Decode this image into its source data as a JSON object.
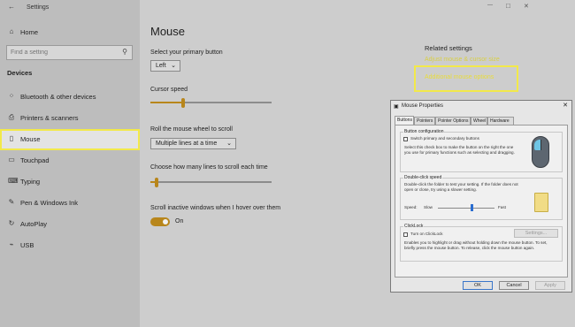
{
  "window": {
    "title": "Settings",
    "back_glyph": "←",
    "minimize_glyph": "—",
    "maximize_glyph": "□",
    "close_glyph": "✕"
  },
  "sidebar": {
    "home_label": "Home",
    "search_placeholder": "Find a setting",
    "section_title": "Devices",
    "items": [
      {
        "label": "Bluetooth & other devices",
        "icon": "bluetooth-icon",
        "glyph": "⁘"
      },
      {
        "label": "Printers & scanners",
        "icon": "printer-icon",
        "glyph": "⎙"
      },
      {
        "label": "Mouse",
        "icon": "mouse-icon",
        "glyph": "▯",
        "active": true
      },
      {
        "label": "Touchpad",
        "icon": "touchpad-icon",
        "glyph": "▭"
      },
      {
        "label": "Typing",
        "icon": "keyboard-icon",
        "glyph": "⌨"
      },
      {
        "label": "Pen & Windows Ink",
        "icon": "pen-icon",
        "glyph": "✎"
      },
      {
        "label": "AutoPlay",
        "icon": "autoplay-icon",
        "glyph": "↻"
      },
      {
        "label": "USB",
        "icon": "usb-icon",
        "glyph": "⌁"
      }
    ]
  },
  "main": {
    "title": "Mouse",
    "primary_button": {
      "label": "Select your primary button",
      "value": "Left"
    },
    "cursor_speed": {
      "label": "Cursor speed",
      "level": 0.27
    },
    "wheel_scroll": {
      "label": "Roll the mouse wheel to scroll",
      "value": "Multiple lines at a time"
    },
    "lines_scroll": {
      "label": "Choose how many lines to scroll each time",
      "level": 0.05
    },
    "inactive_scroll": {
      "label": "Scroll inactive windows when I hover over them",
      "state": "On"
    }
  },
  "related": {
    "title": "Related settings",
    "link_cursor": "Adjust mouse & cursor size",
    "link_additional": "Additional mouse options"
  },
  "dialog": {
    "title": "Mouse Properties",
    "tabs": [
      "Buttons",
      "Pointers",
      "Pointer Options",
      "Wheel",
      "Hardware"
    ],
    "button_config": {
      "title": "Button configuration",
      "checkbox_label": "Switch primary and secondary buttons",
      "desc": "Select this check box to make the button on the right the one you use for primary functions such as selecting and dragging."
    },
    "double_click": {
      "title": "Double-click speed",
      "desc": "Double-click the folder to test your setting. If the folder does not open or close, try using a slower setting.",
      "speed_label": "Speed:",
      "slow_label": "Slow",
      "fast_label": "Fast",
      "level": 0.6
    },
    "clicklock": {
      "title": "ClickLock",
      "checkbox_label": "Turn on ClickLock",
      "settings_button": "Settings...",
      "desc": "Enables you to highlight or drag without holding down the mouse button. To set, briefly press the mouse button. To release, click the mouse button again."
    },
    "buttons": {
      "ok": "OK",
      "cancel": "Cancel",
      "apply": "Apply"
    }
  },
  "colors": {
    "accent": "#b8861b",
    "highlight": "#f2e94a",
    "link": "#e8dc3a"
  }
}
